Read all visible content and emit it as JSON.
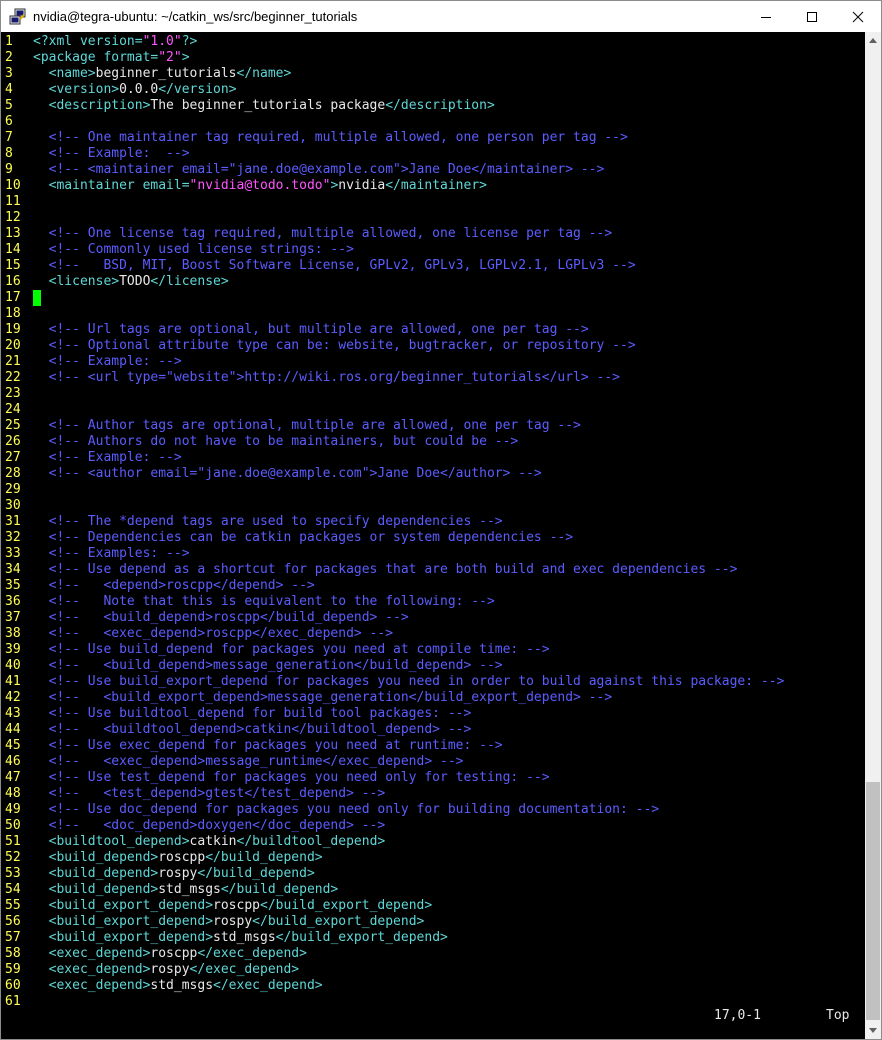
{
  "window": {
    "title": "nvidia@tegra-ubuntu: ~/catkin_ws/src/beginner_tutorials",
    "icon": "putty-icon",
    "buttons": [
      "minimize-icon",
      "maximize-icon",
      "close-icon"
    ]
  },
  "colors": {
    "line_number": "#ffff55",
    "tag": "#5fd7d7",
    "string": "#ff55ff",
    "comment": "#5c5cff",
    "text": "#e8e8e8",
    "cursor": "#00ff00"
  },
  "editor": {
    "lines": [
      {
        "n": "1",
        "t": [
          [
            "tag",
            "<?xml version="
          ],
          [
            "str",
            "\"1.0\""
          ],
          [
            "tag",
            "?>"
          ]
        ]
      },
      {
        "n": "2",
        "t": [
          [
            "tag",
            "<package format="
          ],
          [
            "str",
            "\"2\""
          ],
          [
            "tag",
            ">"
          ]
        ]
      },
      {
        "n": "3",
        "t": [
          [
            "txt",
            "  "
          ],
          [
            "tag",
            "<name>"
          ],
          [
            "txt",
            "beginner_tutorials"
          ],
          [
            "tag",
            "</name>"
          ]
        ]
      },
      {
        "n": "4",
        "t": [
          [
            "txt",
            "  "
          ],
          [
            "tag",
            "<version>"
          ],
          [
            "txt",
            "0.0.0"
          ],
          [
            "tag",
            "</version>"
          ]
        ]
      },
      {
        "n": "5",
        "t": [
          [
            "txt",
            "  "
          ],
          [
            "tag",
            "<description>"
          ],
          [
            "txt",
            "The beginner_tutorials package"
          ],
          [
            "tag",
            "</description>"
          ]
        ]
      },
      {
        "n": "6",
        "t": []
      },
      {
        "n": "7",
        "t": [
          [
            "txt",
            "  "
          ],
          [
            "cmt",
            "<!-- One maintainer tag required, multiple allowed, one person per tag -->"
          ]
        ]
      },
      {
        "n": "8",
        "t": [
          [
            "txt",
            "  "
          ],
          [
            "cmt",
            "<!-- Example:  -->"
          ]
        ]
      },
      {
        "n": "9",
        "t": [
          [
            "txt",
            "  "
          ],
          [
            "cmt",
            "<!-- <maintainer email=\"jane.doe@example.com\">Jane Doe</maintainer> -->"
          ]
        ]
      },
      {
        "n": "10",
        "t": [
          [
            "txt",
            "  "
          ],
          [
            "tag",
            "<maintainer email="
          ],
          [
            "str",
            "\"nvidia@todo.todo\""
          ],
          [
            "tag",
            ">"
          ],
          [
            "txt",
            "nvidia"
          ],
          [
            "tag",
            "</maintainer>"
          ]
        ]
      },
      {
        "n": "11",
        "t": []
      },
      {
        "n": "12",
        "t": []
      },
      {
        "n": "13",
        "t": [
          [
            "txt",
            "  "
          ],
          [
            "cmt",
            "<!-- One license tag required, multiple allowed, one license per tag -->"
          ]
        ]
      },
      {
        "n": "14",
        "t": [
          [
            "txt",
            "  "
          ],
          [
            "cmt",
            "<!-- Commonly used license strings: -->"
          ]
        ]
      },
      {
        "n": "15",
        "t": [
          [
            "txt",
            "  "
          ],
          [
            "cmt",
            "<!--   BSD, MIT, Boost Software License, GPLv2, GPLv3, LGPLv2.1, LGPLv3 -->"
          ]
        ]
      },
      {
        "n": "16",
        "t": [
          [
            "txt",
            "  "
          ],
          [
            "tag",
            "<license>"
          ],
          [
            "txt",
            "TODO"
          ],
          [
            "tag",
            "</license>"
          ]
        ]
      },
      {
        "n": "17",
        "t": [],
        "cursor": true
      },
      {
        "n": "18",
        "t": []
      },
      {
        "n": "19",
        "t": [
          [
            "txt",
            "  "
          ],
          [
            "cmt",
            "<!-- Url tags are optional, but multiple are allowed, one per tag -->"
          ]
        ]
      },
      {
        "n": "20",
        "t": [
          [
            "txt",
            "  "
          ],
          [
            "cmt",
            "<!-- Optional attribute type can be: website, bugtracker, or repository -->"
          ]
        ]
      },
      {
        "n": "21",
        "t": [
          [
            "txt",
            "  "
          ],
          [
            "cmt",
            "<!-- Example: -->"
          ]
        ]
      },
      {
        "n": "22",
        "t": [
          [
            "txt",
            "  "
          ],
          [
            "cmt",
            "<!-- <url type=\"website\">http://wiki.ros.org/beginner_tutorials</url> -->"
          ]
        ]
      },
      {
        "n": "23",
        "t": []
      },
      {
        "n": "24",
        "t": []
      },
      {
        "n": "25",
        "t": [
          [
            "txt",
            "  "
          ],
          [
            "cmt",
            "<!-- Author tags are optional, multiple are allowed, one per tag -->"
          ]
        ]
      },
      {
        "n": "26",
        "t": [
          [
            "txt",
            "  "
          ],
          [
            "cmt",
            "<!-- Authors do not have to be maintainers, but could be -->"
          ]
        ]
      },
      {
        "n": "27",
        "t": [
          [
            "txt",
            "  "
          ],
          [
            "cmt",
            "<!-- Example: -->"
          ]
        ]
      },
      {
        "n": "28",
        "t": [
          [
            "txt",
            "  "
          ],
          [
            "cmt",
            "<!-- <author email=\"jane.doe@example.com\">Jane Doe</author> -->"
          ]
        ]
      },
      {
        "n": "29",
        "t": []
      },
      {
        "n": "30",
        "t": []
      },
      {
        "n": "31",
        "t": [
          [
            "txt",
            "  "
          ],
          [
            "cmt",
            "<!-- The *depend tags are used to specify dependencies -->"
          ]
        ]
      },
      {
        "n": "32",
        "t": [
          [
            "txt",
            "  "
          ],
          [
            "cmt",
            "<!-- Dependencies can be catkin packages or system dependencies -->"
          ]
        ]
      },
      {
        "n": "33",
        "t": [
          [
            "txt",
            "  "
          ],
          [
            "cmt",
            "<!-- Examples: -->"
          ]
        ]
      },
      {
        "n": "34",
        "t": [
          [
            "txt",
            "  "
          ],
          [
            "cmt",
            "<!-- Use depend as a shortcut for packages that are both build and exec dependencies -->"
          ]
        ]
      },
      {
        "n": "35",
        "t": [
          [
            "txt",
            "  "
          ],
          [
            "cmt",
            "<!--   <depend>roscpp</depend> -->"
          ]
        ]
      },
      {
        "n": "36",
        "t": [
          [
            "txt",
            "  "
          ],
          [
            "cmt",
            "<!--   Note that this is equivalent to the following: -->"
          ]
        ]
      },
      {
        "n": "37",
        "t": [
          [
            "txt",
            "  "
          ],
          [
            "cmt",
            "<!--   <build_depend>roscpp</build_depend> -->"
          ]
        ]
      },
      {
        "n": "38",
        "t": [
          [
            "txt",
            "  "
          ],
          [
            "cmt",
            "<!--   <exec_depend>roscpp</exec_depend> -->"
          ]
        ]
      },
      {
        "n": "39",
        "t": [
          [
            "txt",
            "  "
          ],
          [
            "cmt",
            "<!-- Use build_depend for packages you need at compile time: -->"
          ]
        ]
      },
      {
        "n": "40",
        "t": [
          [
            "txt",
            "  "
          ],
          [
            "cmt",
            "<!--   <build_depend>message_generation</build_depend> -->"
          ]
        ]
      },
      {
        "n": "41",
        "t": [
          [
            "txt",
            "  "
          ],
          [
            "cmt",
            "<!-- Use build_export_depend for packages you need in order to build against this package: -->"
          ]
        ]
      },
      {
        "n": "42",
        "t": [
          [
            "txt",
            "  "
          ],
          [
            "cmt",
            "<!--   <build_export_depend>message_generation</build_export_depend> -->"
          ]
        ]
      },
      {
        "n": "43",
        "t": [
          [
            "txt",
            "  "
          ],
          [
            "cmt",
            "<!-- Use buildtool_depend for build tool packages: -->"
          ]
        ]
      },
      {
        "n": "44",
        "t": [
          [
            "txt",
            "  "
          ],
          [
            "cmt",
            "<!--   <buildtool_depend>catkin</buildtool_depend> -->"
          ]
        ]
      },
      {
        "n": "45",
        "t": [
          [
            "txt",
            "  "
          ],
          [
            "cmt",
            "<!-- Use exec_depend for packages you need at runtime: -->"
          ]
        ]
      },
      {
        "n": "46",
        "t": [
          [
            "txt",
            "  "
          ],
          [
            "cmt",
            "<!--   <exec_depend>message_runtime</exec_depend> -->"
          ]
        ]
      },
      {
        "n": "47",
        "t": [
          [
            "txt",
            "  "
          ],
          [
            "cmt",
            "<!-- Use test_depend for packages you need only for testing: -->"
          ]
        ]
      },
      {
        "n": "48",
        "t": [
          [
            "txt",
            "  "
          ],
          [
            "cmt",
            "<!--   <test_depend>gtest</test_depend> -->"
          ]
        ]
      },
      {
        "n": "49",
        "t": [
          [
            "txt",
            "  "
          ],
          [
            "cmt",
            "<!-- Use doc_depend for packages you need only for building documentation: -->"
          ]
        ]
      },
      {
        "n": "50",
        "t": [
          [
            "txt",
            "  "
          ],
          [
            "cmt",
            "<!--   <doc_depend>doxygen</doc_depend> -->"
          ]
        ]
      },
      {
        "n": "51",
        "t": [
          [
            "txt",
            "  "
          ],
          [
            "tag",
            "<buildtool_depend>"
          ],
          [
            "txt",
            "catkin"
          ],
          [
            "tag",
            "</buildtool_depend>"
          ]
        ]
      },
      {
        "n": "52",
        "t": [
          [
            "txt",
            "  "
          ],
          [
            "tag",
            "<build_depend>"
          ],
          [
            "txt",
            "roscpp"
          ],
          [
            "tag",
            "</build_depend>"
          ]
        ]
      },
      {
        "n": "53",
        "t": [
          [
            "txt",
            "  "
          ],
          [
            "tag",
            "<build_depend>"
          ],
          [
            "txt",
            "rospy"
          ],
          [
            "tag",
            "</build_depend>"
          ]
        ]
      },
      {
        "n": "54",
        "t": [
          [
            "txt",
            "  "
          ],
          [
            "tag",
            "<build_depend>"
          ],
          [
            "txt",
            "std_msgs"
          ],
          [
            "tag",
            "</build_depend>"
          ]
        ]
      },
      {
        "n": "55",
        "t": [
          [
            "txt",
            "  "
          ],
          [
            "tag",
            "<build_export_depend>"
          ],
          [
            "txt",
            "roscpp"
          ],
          [
            "tag",
            "</build_export_depend>"
          ]
        ]
      },
      {
        "n": "56",
        "t": [
          [
            "txt",
            "  "
          ],
          [
            "tag",
            "<build_export_depend>"
          ],
          [
            "txt",
            "rospy"
          ],
          [
            "tag",
            "</build_export_depend>"
          ]
        ]
      },
      {
        "n": "57",
        "t": [
          [
            "txt",
            "  "
          ],
          [
            "tag",
            "<build_export_depend>"
          ],
          [
            "txt",
            "std_msgs"
          ],
          [
            "tag",
            "</build_export_depend>"
          ]
        ]
      },
      {
        "n": "58",
        "t": [
          [
            "txt",
            "  "
          ],
          [
            "tag",
            "<exec_depend>"
          ],
          [
            "txt",
            "roscpp"
          ],
          [
            "tag",
            "</exec_depend>"
          ]
        ]
      },
      {
        "n": "59",
        "t": [
          [
            "txt",
            "  "
          ],
          [
            "tag",
            "<exec_depend>"
          ],
          [
            "txt",
            "rospy"
          ],
          [
            "tag",
            "</exec_depend>"
          ]
        ]
      },
      {
        "n": "60",
        "t": [
          [
            "txt",
            "  "
          ],
          [
            "tag",
            "<exec_depend>"
          ],
          [
            "txt",
            "std_msgs"
          ],
          [
            "tag",
            "</exec_depend>"
          ]
        ]
      },
      {
        "n": "61",
        "t": []
      }
    ]
  },
  "statusline": {
    "cursor_position": "17,0-1",
    "scroll_position": "Top"
  }
}
